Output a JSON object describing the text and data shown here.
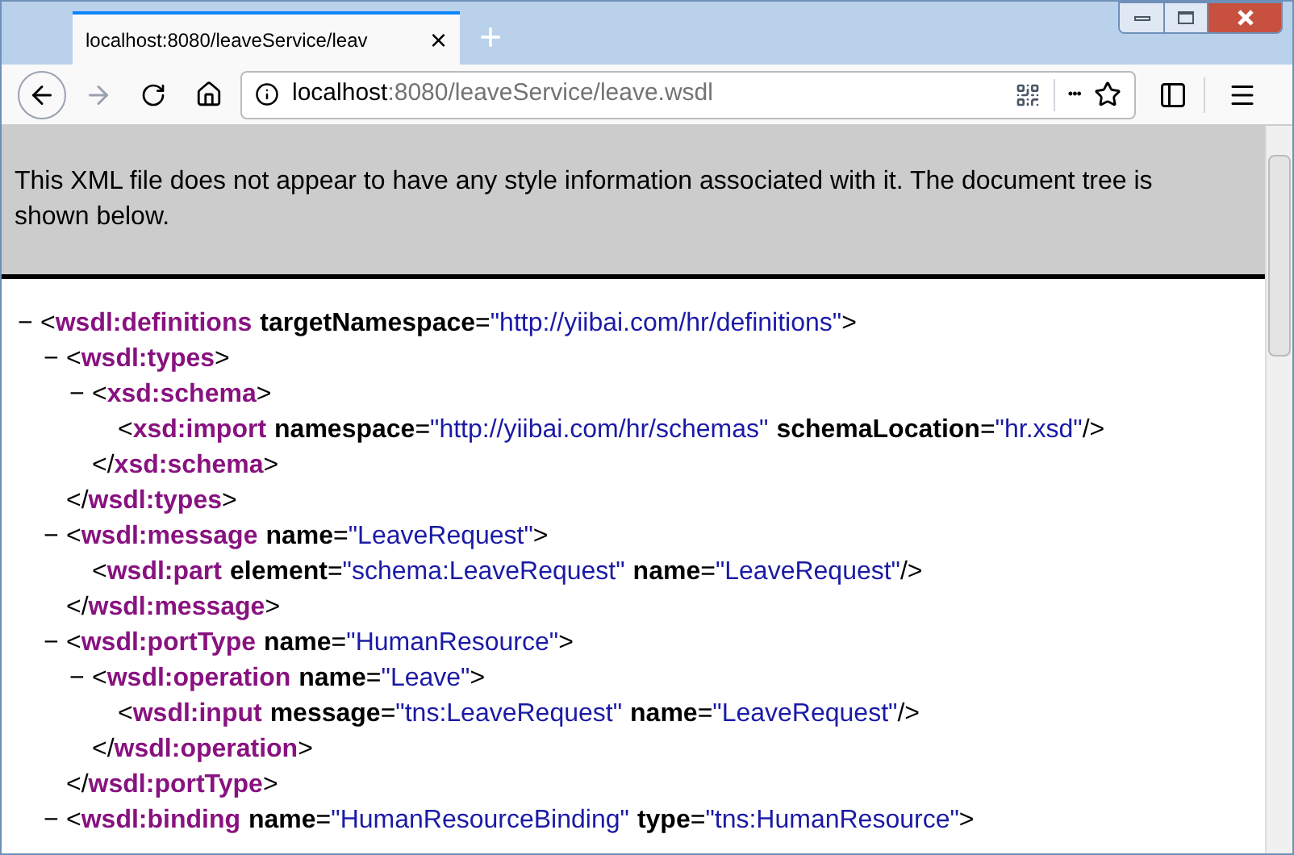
{
  "tab": {
    "title": "localhost:8080/leaveService/leav",
    "close": "×",
    "selected": true
  },
  "new_tab": "+",
  "address": {
    "host": "localhost",
    "path": ":8080/leaveService/leave.wsdl"
  },
  "more": "•••",
  "notice": "This XML file does not appear to have any style information associated with it. The document tree is shown below.",
  "tree": [
    {
      "toggle": "−",
      "open": [
        {
          "kind": "p",
          "text": "<"
        },
        {
          "kind": "tag",
          "text": "wsdl:definitions"
        },
        {
          "kind": "attr",
          "text": "targetNamespace"
        },
        {
          "kind": "p",
          "text": "="
        },
        {
          "kind": "val",
          "text": "\"http://yiibai.com/hr/definitions\""
        },
        {
          "kind": "p",
          "text": ">"
        }
      ],
      "children": [
        {
          "toggle": "−",
          "open": [
            {
              "kind": "p",
              "text": "<"
            },
            {
              "kind": "tag",
              "text": "wsdl:types"
            },
            {
              "kind": "p",
              "text": ">"
            }
          ],
          "children": [
            {
              "toggle": "−",
              "open": [
                {
                  "kind": "p",
                  "text": "<"
                },
                {
                  "kind": "tag",
                  "text": "xsd:schema"
                },
                {
                  "kind": "p",
                  "text": ">"
                }
              ],
              "children": [
                {
                  "open": [
                    {
                      "kind": "p",
                      "text": "<"
                    },
                    {
                      "kind": "tag",
                      "text": "xsd:import"
                    },
                    {
                      "kind": "attr",
                      "text": "namespace"
                    },
                    {
                      "kind": "p",
                      "text": "="
                    },
                    {
                      "kind": "val",
                      "text": "\"http://yiibai.com/hr/schemas\""
                    },
                    {
                      "kind": "attr",
                      "text": "schemaLocation"
                    },
                    {
                      "kind": "p",
                      "text": "="
                    },
                    {
                      "kind": "val",
                      "text": "\"hr.xsd\""
                    },
                    {
                      "kind": "p",
                      "text": "/>"
                    }
                  ]
                }
              ],
              "close": [
                {
                  "kind": "p",
                  "text": "</"
                },
                {
                  "kind": "tag",
                  "text": "xsd:schema"
                },
                {
                  "kind": "p",
                  "text": ">"
                }
              ]
            }
          ],
          "close": [
            {
              "kind": "p",
              "text": "</"
            },
            {
              "kind": "tag",
              "text": "wsdl:types"
            },
            {
              "kind": "p",
              "text": ">"
            }
          ]
        },
        {
          "toggle": "−",
          "open": [
            {
              "kind": "p",
              "text": "<"
            },
            {
              "kind": "tag",
              "text": "wsdl:message"
            },
            {
              "kind": "attr",
              "text": "name"
            },
            {
              "kind": "p",
              "text": "="
            },
            {
              "kind": "val",
              "text": "\"LeaveRequest\""
            },
            {
              "kind": "p",
              "text": ">"
            }
          ],
          "children": [
            {
              "open": [
                {
                  "kind": "p",
                  "text": "<"
                },
                {
                  "kind": "tag",
                  "text": "wsdl:part"
                },
                {
                  "kind": "attr",
                  "text": "element"
                },
                {
                  "kind": "p",
                  "text": "="
                },
                {
                  "kind": "val",
                  "text": "\"schema:LeaveRequest\""
                },
                {
                  "kind": "attr",
                  "text": "name"
                },
                {
                  "kind": "p",
                  "text": "="
                },
                {
                  "kind": "val",
                  "text": "\"LeaveRequest\""
                },
                {
                  "kind": "p",
                  "text": "/>"
                }
              ]
            }
          ],
          "close": [
            {
              "kind": "p",
              "text": "</"
            },
            {
              "kind": "tag",
              "text": "wsdl:message"
            },
            {
              "kind": "p",
              "text": ">"
            }
          ]
        },
        {
          "toggle": "−",
          "open": [
            {
              "kind": "p",
              "text": "<"
            },
            {
              "kind": "tag",
              "text": "wsdl:portType"
            },
            {
              "kind": "attr",
              "text": "name"
            },
            {
              "kind": "p",
              "text": "="
            },
            {
              "kind": "val",
              "text": "\"HumanResource\""
            },
            {
              "kind": "p",
              "text": ">"
            }
          ],
          "children": [
            {
              "toggle": "−",
              "open": [
                {
                  "kind": "p",
                  "text": "<"
                },
                {
                  "kind": "tag",
                  "text": "wsdl:operation"
                },
                {
                  "kind": "attr",
                  "text": "name"
                },
                {
                  "kind": "p",
                  "text": "="
                },
                {
                  "kind": "val",
                  "text": "\"Leave\""
                },
                {
                  "kind": "p",
                  "text": ">"
                }
              ],
              "children": [
                {
                  "open": [
                    {
                      "kind": "p",
                      "text": "<"
                    },
                    {
                      "kind": "tag",
                      "text": "wsdl:input"
                    },
                    {
                      "kind": "attr",
                      "text": "message"
                    },
                    {
                      "kind": "p",
                      "text": "="
                    },
                    {
                      "kind": "val",
                      "text": "\"tns:LeaveRequest\""
                    },
                    {
                      "kind": "attr",
                      "text": "name"
                    },
                    {
                      "kind": "p",
                      "text": "="
                    },
                    {
                      "kind": "val",
                      "text": "\"LeaveRequest\""
                    },
                    {
                      "kind": "p",
                      "text": "/>"
                    }
                  ]
                }
              ],
              "close": [
                {
                  "kind": "p",
                  "text": "</"
                },
                {
                  "kind": "tag",
                  "text": "wsdl:operation"
                },
                {
                  "kind": "p",
                  "text": ">"
                }
              ]
            }
          ],
          "close": [
            {
              "kind": "p",
              "text": "</"
            },
            {
              "kind": "tag",
              "text": "wsdl:portType"
            },
            {
              "kind": "p",
              "text": ">"
            }
          ]
        },
        {
          "toggle": "−",
          "open": [
            {
              "kind": "p",
              "text": "<"
            },
            {
              "kind": "tag",
              "text": "wsdl:binding"
            },
            {
              "kind": "attr",
              "text": "name"
            },
            {
              "kind": "p",
              "text": "="
            },
            {
              "kind": "val",
              "text": "\"HumanResourceBinding\""
            },
            {
              "kind": "attr",
              "text": "type"
            },
            {
              "kind": "p",
              "text": "="
            },
            {
              "kind": "val",
              "text": "\"tns:HumanResource\""
            },
            {
              "kind": "p",
              "text": ">"
            }
          ]
        }
      ]
    }
  ]
}
